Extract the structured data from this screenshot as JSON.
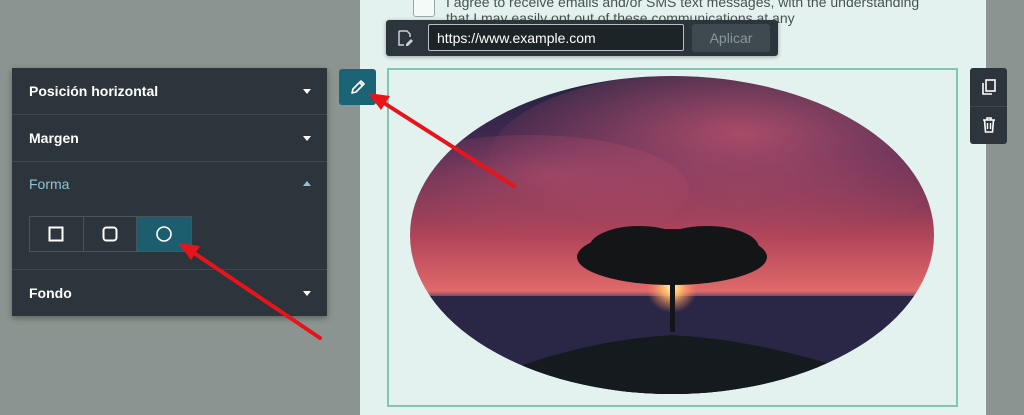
{
  "consent": {
    "text": "I agree to receive emails and/or SMS text messages, with the understanding that I may easily opt out of these communications at any"
  },
  "url_bar": {
    "value": "https://www.example.com",
    "apply_label": "Aplicar",
    "icon": "link-edit-icon"
  },
  "panel": {
    "rows": [
      {
        "label": "Posición horizontal",
        "expanded": false
      },
      {
        "label": "Margen",
        "expanded": false
      },
      {
        "label": "Forma",
        "expanded": true
      },
      {
        "label": "Fondo",
        "expanded": false
      }
    ],
    "shape_options": [
      {
        "icon": "square-icon",
        "selected": false
      },
      {
        "icon": "rounded-square-icon",
        "selected": false
      },
      {
        "icon": "circle-icon",
        "selected": true
      }
    ]
  },
  "tools": {
    "edit_icon": "pencil-icon",
    "duplicate_icon": "copy-icon",
    "delete_icon": "trash-icon"
  },
  "image": {
    "shape": "circle",
    "subject": "tree-at-sunset-over-sea"
  },
  "colors": {
    "panel_bg": "#2c353b",
    "accent": "#1b6476",
    "frame_border": "#7fc7b0",
    "annotation_arrow": "#e8141c"
  }
}
